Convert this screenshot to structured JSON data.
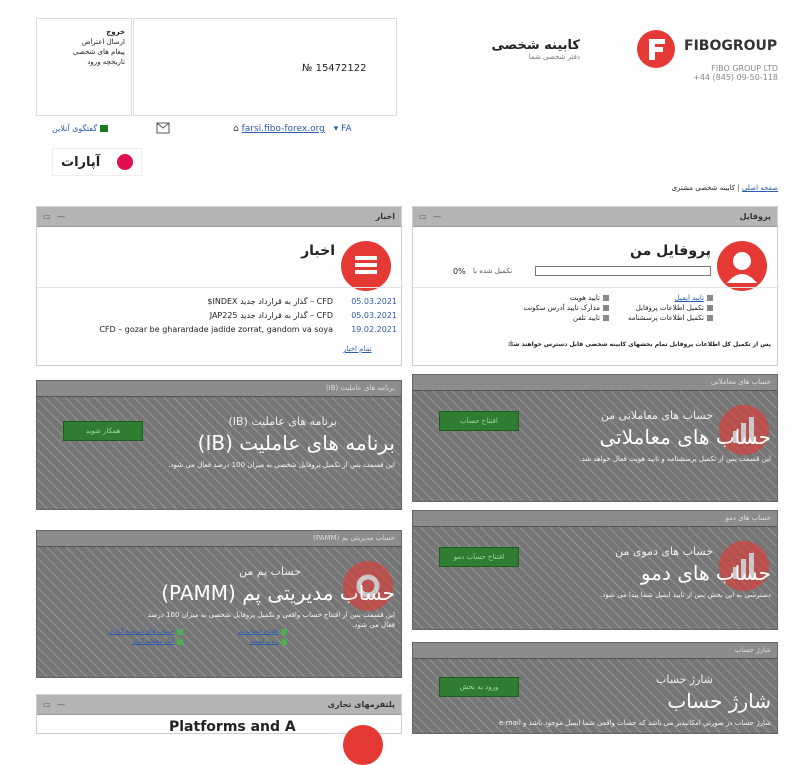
{
  "header": {
    "logo_text": "FIBOGROUP",
    "company": "FIBO GROUP LTD",
    "phone": "+44 (845) 09-50-118",
    "cabinet_title": "کابینه شخصی",
    "cabinet_subtitle": "دفتر شخصی شما",
    "account_number": "№ 15472122",
    "menu_items": [
      "خروج",
      "ارسال اعتراض",
      "پیغام های شخصی",
      "تاریخچه ورود"
    ],
    "online_support": "گفتگوی آنلاین",
    "site_link": "farsi.fibo-forex.org",
    "lang": "FA",
    "aparat": "آپارات"
  },
  "breadcrumb": {
    "home": "صفحه اصلی",
    "current": "کابینه شخصی مشتری"
  },
  "profile": {
    "panel_title": "پروفایل",
    "title": "پروفایل من",
    "progress_label": "تکمیل شده با",
    "progress_pct": "0%",
    "progress_value": 0,
    "items_left": [
      "تایید ایمیل",
      "تکمیل اطلاعات پروفایل",
      "تکمیل اطلاعات پرسشنامه"
    ],
    "items_right": [
      "تایید هویت",
      "مدارک تایید آدرس سکونت",
      "تایید تلفن"
    ],
    "note": "پس از تکمیل کل اطلاعات پروفایل تمام بخشهای کابینه شخصی قابل دسترس خواهند شد."
  },
  "news": {
    "panel_title": "اخبار",
    "title": "اخبار",
    "rows": [
      {
        "date": "05.03.2021",
        "text": "CFD – گذار به قرارداد جدید INDEX$"
      },
      {
        "date": "05.03.2021",
        "text": "CFD – گذار به قرارداد جدید JAP225"
      },
      {
        "date": "19.02.2021",
        "text": "CFD – gozar be gharardade jadide zorrat, gandom va soya"
      }
    ],
    "all_news": "تمام اخبار"
  },
  "trading": {
    "panel_title": "حساب های معاملاتی",
    "subtitle": "حساب های معاملاتی من",
    "title": "حساب های معاملاتی",
    "desc": "این قسمت پس از تکمیل پرسشنامه و تایید هویت فعال خواهد شد.",
    "button": "افتتاح حساب"
  },
  "ib": {
    "panel_title": "برنامه های عاملیت (IB)",
    "subtitle": "برنامه های عاملیت (IB)",
    "title": "برنامه های عاملیت (IB)",
    "desc": "این قسمت پس از تکمیل پروفایل شخصی به میزان 100 درصد فعال می شود.",
    "button": "همکار شوید"
  },
  "demo": {
    "panel_title": "حساب های دمو",
    "subtitle": "حساب های دموی من",
    "title": "حساب های دمو",
    "desc": "دسترسی به این بخش پس از تایید ایمیل شما پیدا می شود.",
    "button": "افتتاح حساب دمو"
  },
  "pamm": {
    "panel_title": "حساب مدیریتی پم (PAMM)",
    "subtitle": "حساب پم من",
    "title": "حساب مدیریتی پم (PAMM)",
    "desc": "این قسمت پس از افتتاح حساب واقعی و تکمیل پروفایل شخصی به میزان 100 درصد",
    "desc2": "فعال می شود.",
    "links": [
      "افتتاح حساب پم",
      "حساب های سرمایه گذاری",
      "دیدن لیست",
      "پرتفوی ها",
      "رتبه بندی",
      "آمار معامله گران"
    ]
  },
  "charge": {
    "panel_title": "شارژ حساب",
    "subtitle": "شارژ حساب",
    "title": "شارژ حساب",
    "desc": "شارژ حساب در صورتی امکانپذیر می باشد که حساب واقعی شما ایمیل موجود باشد و e-mail",
    "button": "ورود به بخش"
  },
  "platforms": {
    "panel_title": "پلتفرمهای تجاری",
    "title": "Platforms and A"
  }
}
